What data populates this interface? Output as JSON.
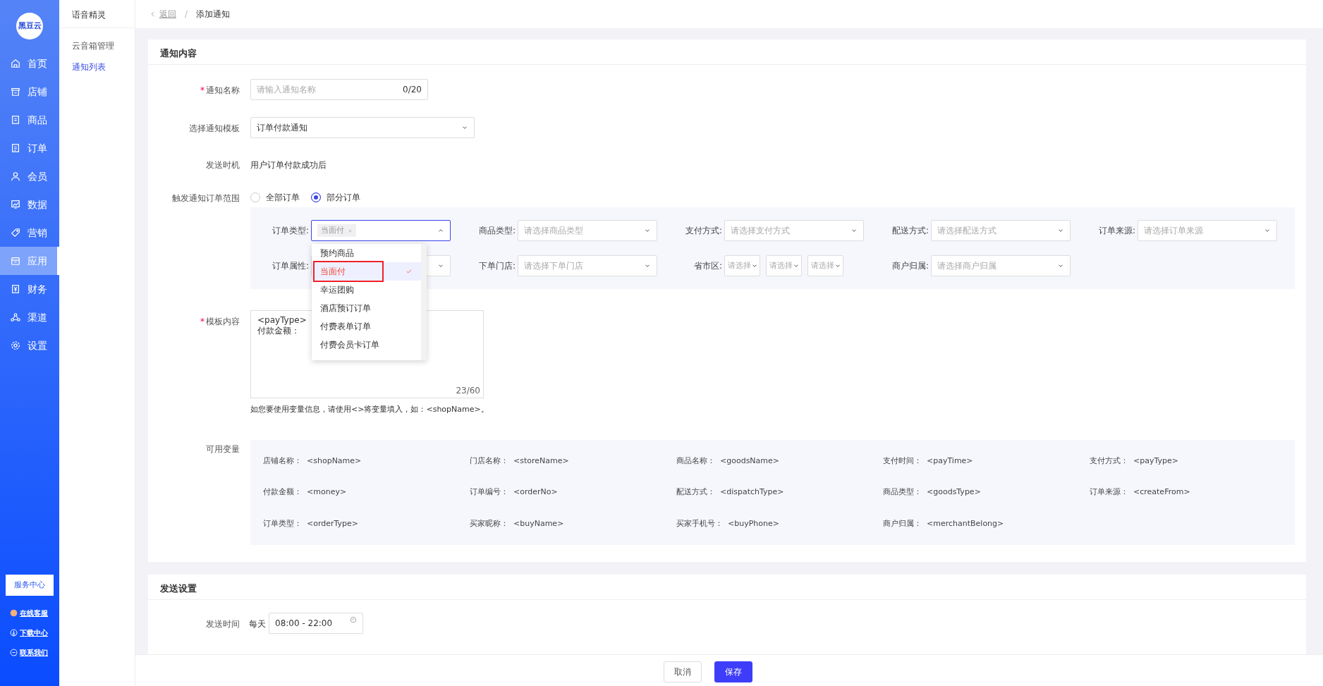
{
  "sidebar": {
    "logo": "黑豆云",
    "items": [
      {
        "label": "首页",
        "selected": false
      },
      {
        "label": "店铺",
        "selected": false
      },
      {
        "label": "商品",
        "selected": false
      },
      {
        "label": "订单",
        "selected": false
      },
      {
        "label": "会员",
        "selected": false
      },
      {
        "label": "数据",
        "selected": false
      },
      {
        "label": "营销",
        "selected": false
      },
      {
        "label": "应用",
        "selected": true
      },
      {
        "label": "财务",
        "selected": false
      },
      {
        "label": "渠道",
        "selected": false
      },
      {
        "label": "设置",
        "selected": false
      }
    ],
    "service_button": "服务中心",
    "links": [
      "在线客服",
      "下载中心",
      "联系我们"
    ]
  },
  "subnav": {
    "title": "语音精灵",
    "items": [
      {
        "label": "云音箱管理",
        "selected": false
      },
      {
        "label": "通知列表",
        "selected": true
      }
    ]
  },
  "breadcrumb": {
    "back": "返回",
    "separator": "/",
    "current": "添加通知"
  },
  "content_card": {
    "title": "通知内容",
    "name_field": {
      "required_mark": "*",
      "label": "通知名称",
      "placeholder": "请输入通知名称",
      "counter": "0/20"
    },
    "template_field": {
      "label": "选择通知模板",
      "value": "订单付款通知"
    },
    "send_timing": {
      "label": "发送时机",
      "value": "用户订单付款成功后"
    },
    "order_scope": {
      "label": "触发通知订单范围",
      "options": [
        {
          "label": "全部订单",
          "selected": false
        },
        {
          "label": "部分订单",
          "selected": true
        }
      ]
    },
    "filters": [
      {
        "kind": "tags",
        "label": "订单类型:",
        "tags": [
          "当面付"
        ],
        "expanded": true
      },
      {
        "kind": "select",
        "label": "商品类型:",
        "placeholder": "请选择商品类型"
      },
      {
        "kind": "select",
        "label": "支付方式:",
        "placeholder": "请选择支付方式"
      },
      {
        "kind": "select",
        "label": "配送方式:",
        "placeholder": "请选择配送方式"
      },
      {
        "kind": "select",
        "label": "订单来源:",
        "placeholder": "请选择订单来源"
      },
      {
        "kind": "select",
        "label": "订单属性:"
      },
      {
        "kind": "select",
        "label": "下单门店:",
        "placeholder": "请选择下单门店"
      },
      {
        "kind": "region",
        "label": "省市区:",
        "placeholders": [
          "请选择",
          "请选择",
          "请选择"
        ]
      },
      {
        "kind": "select",
        "label": "商户归属:",
        "placeholder": "请选择商户归属"
      }
    ],
    "dropdown": {
      "options": [
        {
          "label": "预约商品",
          "selected": false,
          "highlighted": false
        },
        {
          "label": "当面付",
          "selected": true,
          "highlighted": true
        },
        {
          "label": "幸运团购",
          "selected": false,
          "highlighted": false
        },
        {
          "label": "酒店预订订单",
          "selected": false,
          "highlighted": false
        },
        {
          "label": "付费表单订单",
          "selected": false,
          "highlighted": false
        },
        {
          "label": "付费会员卡订单",
          "selected": false,
          "highlighted": false
        }
      ]
    },
    "template_content": {
      "required_mark": "*",
      "label": "模板内容",
      "lines": [
        "<payType>",
        "付款金额："
      ],
      "counter": "23/60"
    },
    "hint": "如您要使用变量信息，请使用<>将变量填入，如：<shopName>。",
    "variables": {
      "label": "可用变量",
      "items": [
        {
          "name": "店铺名称：",
          "token": "<shopName>"
        },
        {
          "name": "门店名称：",
          "token": "<storeName>"
        },
        {
          "name": "商品名称：",
          "token": "<goodsName>"
        },
        {
          "name": "支付时间：",
          "token": "<payTime>"
        },
        {
          "name": "支付方式：",
          "token": "<payType>"
        },
        {
          "name": "付款金额：",
          "token": "<money>"
        },
        {
          "name": "订单编号：",
          "token": "<orderNo>"
        },
        {
          "name": "配送方式：",
          "token": "<dispatchType>"
        },
        {
          "name": "商品类型：",
          "token": "<goodsType>"
        },
        {
          "name": "订单来源：",
          "token": "<createFrom>"
        },
        {
          "name": "订单类型：",
          "token": "<orderType>"
        },
        {
          "name": "买家昵称：",
          "token": "<buyName>"
        },
        {
          "name": "买家手机号：",
          "token": "<buyPhone>"
        },
        {
          "name": "商户归属：",
          "token": "<merchantBelong>"
        }
      ]
    }
  },
  "send_card": {
    "title": "发送设置",
    "time": {
      "label": "发送时间",
      "prefix": "每天",
      "value": "08:00 - 22:00"
    }
  },
  "footer": {
    "buttons": [
      {
        "kind": "secondary",
        "label": "取消"
      },
      {
        "kind": "primary",
        "label": "保存"
      }
    ]
  }
}
